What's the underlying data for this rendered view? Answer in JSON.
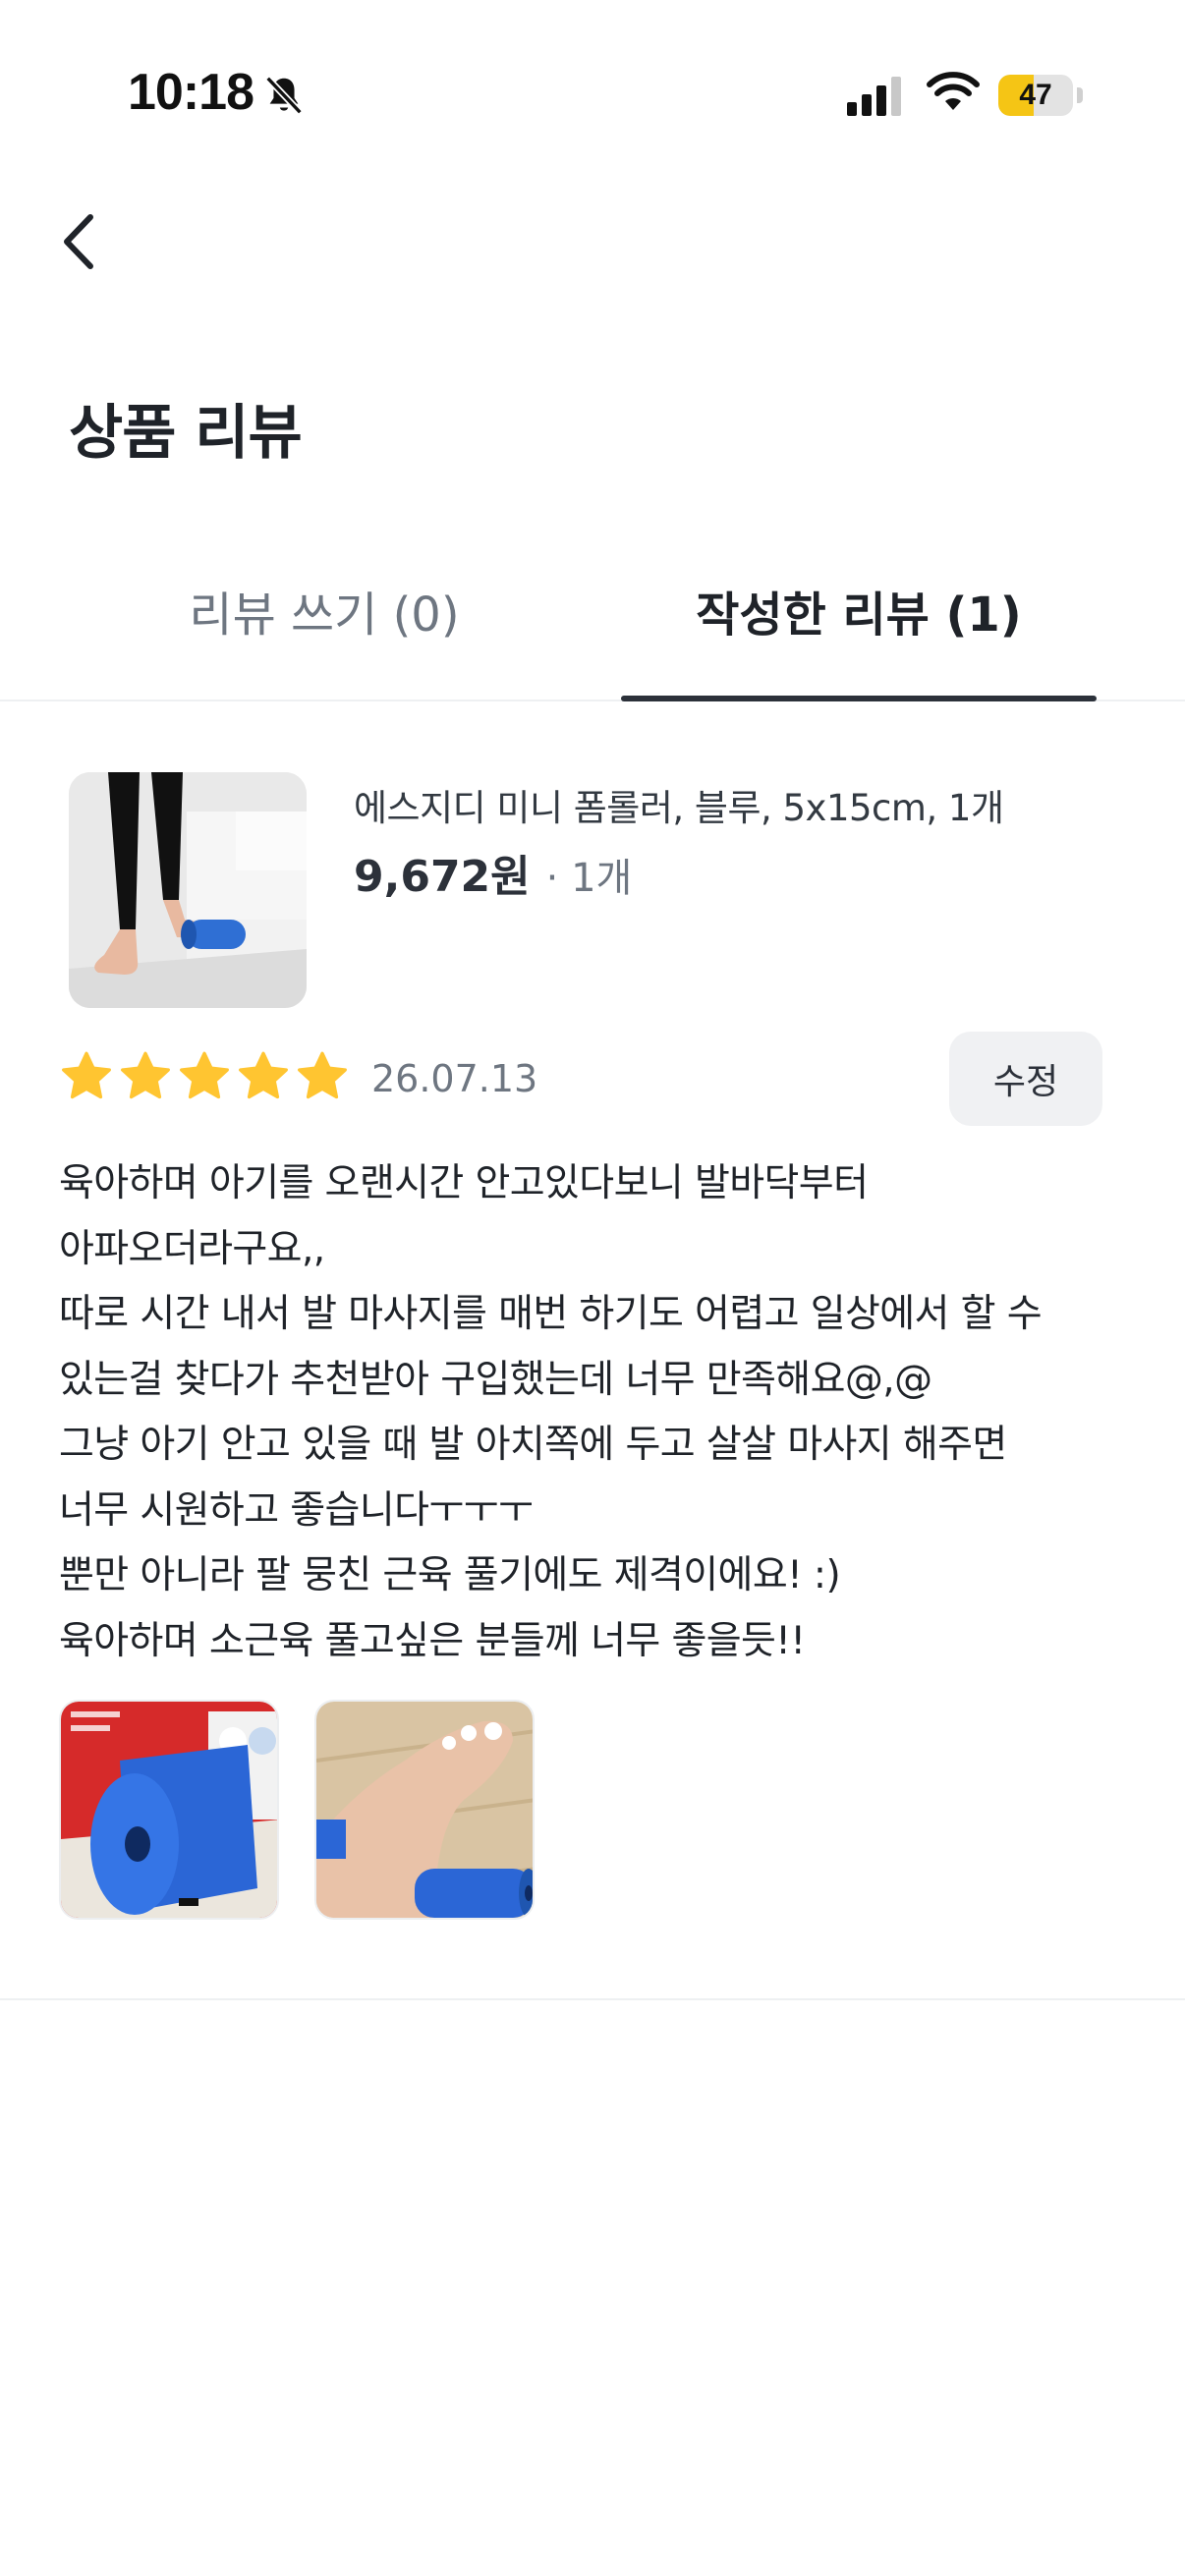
{
  "status_bar": {
    "time": "10:18",
    "battery_level": "47",
    "battery_fraction": 0.47,
    "icons": [
      "bell-slash-icon",
      "cellular-signal-icon",
      "wifi-icon",
      "battery-icon"
    ]
  },
  "header": {
    "back_icon": "chevron-left-icon",
    "title": "상품 리뷰"
  },
  "tabs": [
    {
      "label": "리뷰 쓰기 (0)",
      "active": false
    },
    {
      "label": "작성한 리뷰 (1)",
      "active": true
    }
  ],
  "review": {
    "product": {
      "name": "에스지디 미니 폼롤러, 블루, 5x15cm, 1개",
      "price": "9,672원",
      "quantity": "· 1개"
    },
    "rating": 5,
    "rating_max": 5,
    "date": "26.07.13",
    "edit_label": "수정",
    "text_lines": [
      "육아하며 아기를 오랜시간 안고있다보니 발바닥부터",
      "아파오더라구요,,",
      "따로 시간 내서 발 마사지를 매번 하기도 어렵고 일상에서 할 수",
      "있는걸 찾다가 추천받아 구입했는데 너무 만족해요@,@",
      "그냥 아기 안고 있을 때 발 아치쪽에 두고 살살 마사지 해주면",
      "너무 시원하고 좋습니다ㅜㅜㅜ",
      "뿐만 아니라 팔 뭉친 근육 풀기에도 제격이에요! :)",
      "육아하며 소근육 풀고싶은 분들께 너무 좋을듯!!"
    ],
    "photo_count": 2
  },
  "colors": {
    "star": "#FFC531",
    "active_tab_indicator": "#2C313A",
    "muted_text": "#6E7681",
    "edit_button_bg": "#F0F1F3",
    "battery": "#F5C515"
  }
}
